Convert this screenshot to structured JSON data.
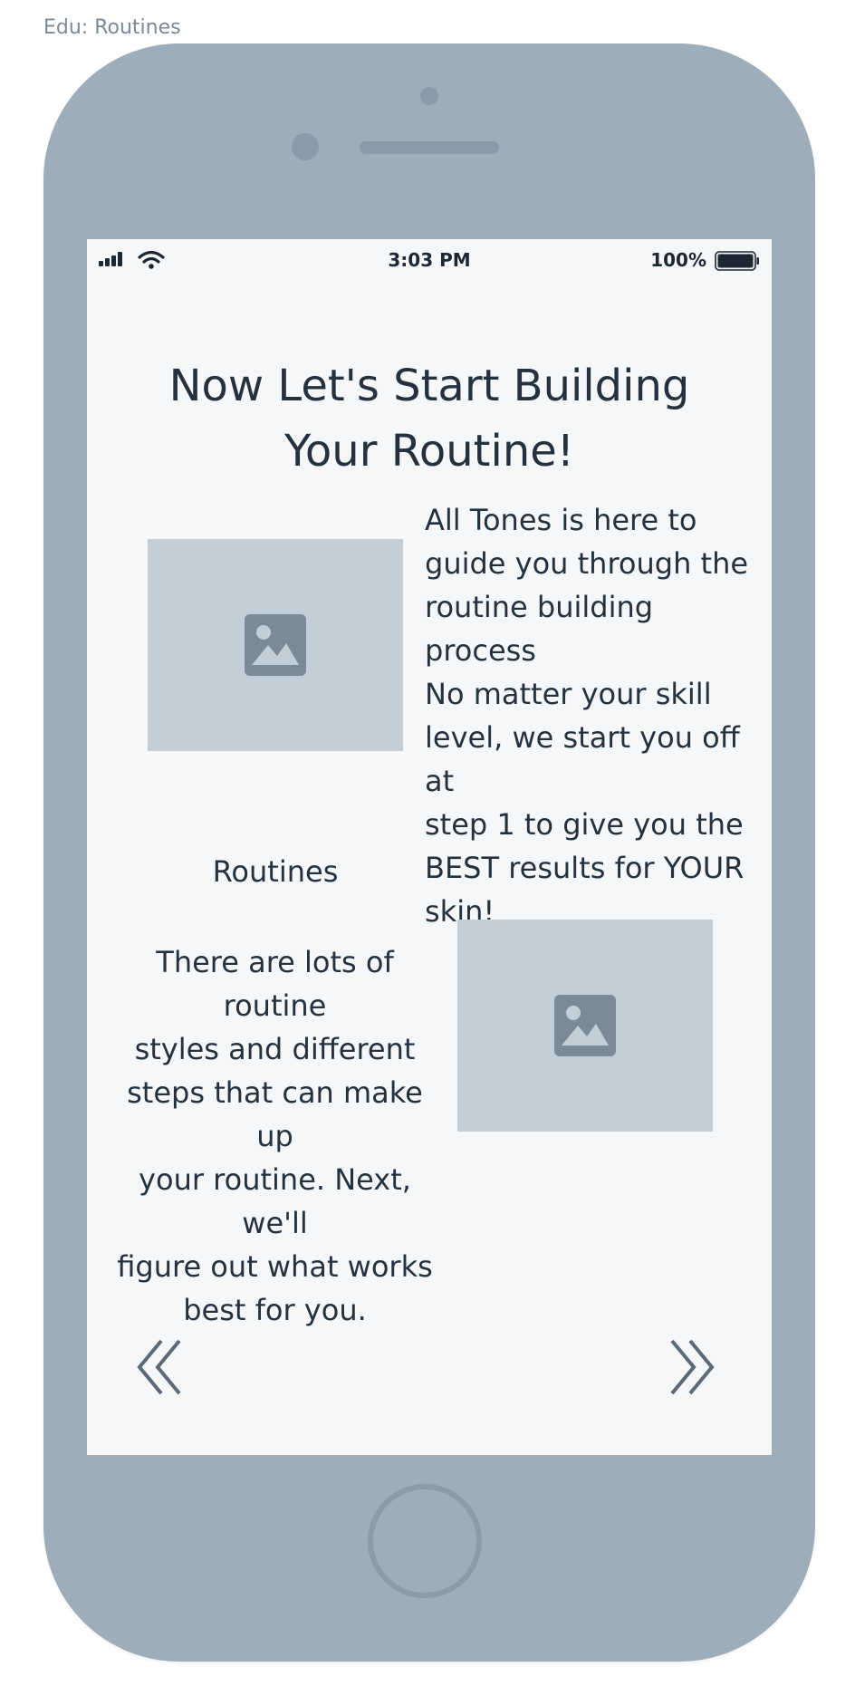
{
  "artboard": {
    "label": "Edu: Routines"
  },
  "status_bar": {
    "time": "3:03 PM",
    "battery": "100%",
    "icons": [
      "cellular-signal-icon",
      "wifi-icon",
      "battery-icon"
    ]
  },
  "content": {
    "title": "Now Let's Start Building\nYour Routine!",
    "intro_text": "All Tones is here to\nguide you through the\nroutine building process\nNo matter your skill\nlevel, we start you off at\nstep 1 to give you the\nBEST results for YOUR\nskin!",
    "section_label": "Routines",
    "routines_text": "There are lots of routine\nstyles and different\nsteps that can  make up\nyour routine. Next, we'll\nfigure out what works\nbest for you.",
    "images": [
      "image-placeholder-icon",
      "image-placeholder-icon"
    ]
  },
  "navigation": {
    "back_icon": "double-chevron-left-icon",
    "next_icon": "double-chevron-right-icon"
  },
  "colors": {
    "phone_body": "#9eadba",
    "screen_bg": "#f6f7f9",
    "text": "#24323f",
    "image_placeholder": "#c2cfd9",
    "image_icon": "#7b8a97"
  }
}
